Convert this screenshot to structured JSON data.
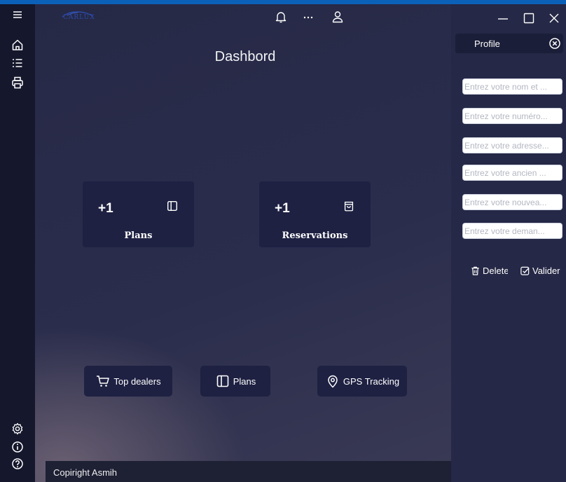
{
  "app": {
    "logo_text": "CARLUX"
  },
  "header": {
    "title": "Dashbord"
  },
  "stats": [
    {
      "value": "+1",
      "label": "Plans",
      "icon": "panel-icon"
    },
    {
      "value": "+1",
      "label": "Reservations",
      "icon": "bag-icon"
    }
  ],
  "shortcuts": [
    {
      "label": "Top dealers",
      "icon": "cart-icon"
    },
    {
      "label": "Plans",
      "icon": "panel-icon"
    },
    {
      "label": "GPS Tracking",
      "icon": "location-pin-icon"
    }
  ],
  "footer": {
    "text": "Copiright Asmih"
  },
  "profile": {
    "title": "Profile",
    "fields": [
      {
        "placeholder": "Entrez votre nom et ...",
        "value": ""
      },
      {
        "placeholder": "Entrez votre numéro...",
        "value": ""
      },
      {
        "placeholder": "Entrez votre adresse...",
        "value": ""
      },
      {
        "placeholder": "Entrez votre ancien ...",
        "value": ""
      },
      {
        "placeholder": "Entrez votre nouvea...",
        "value": ""
      },
      {
        "placeholder": "Entrez votre deman...",
        "value": ""
      }
    ],
    "actions": {
      "delete_label": "Delete",
      "validate_label": "Valider"
    }
  },
  "colors": {
    "rail_bg": "#15172c",
    "main_bg": "#272a49",
    "card_bg": "#1e2142",
    "panel_bg": "#252846",
    "desktop_accent": "#0b61b8"
  }
}
